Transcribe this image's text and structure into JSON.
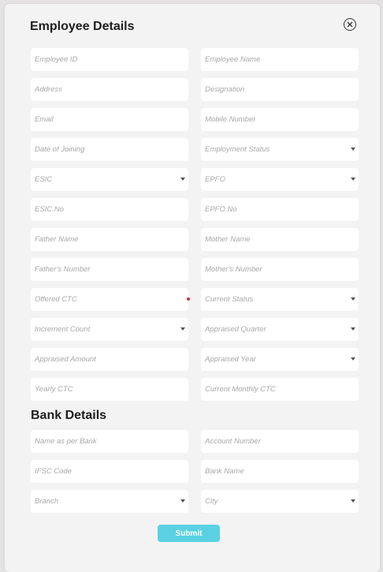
{
  "modal": {
    "title": "Employee Details",
    "bank_title": "Bank Details",
    "submit_label": "Submit"
  },
  "employee_fields": [
    {
      "label": "Employee ID",
      "type": "text"
    },
    {
      "label": "Employee Name",
      "type": "text"
    },
    {
      "label": "Address",
      "type": "text"
    },
    {
      "label": "Designation",
      "type": "text"
    },
    {
      "label": "Email",
      "type": "text"
    },
    {
      "label": "Mobile Number",
      "type": "text"
    },
    {
      "label": "Date of Joining",
      "type": "text"
    },
    {
      "label": "Employment Status",
      "type": "select"
    },
    {
      "label": "ESIC",
      "type": "select"
    },
    {
      "label": "EPFO",
      "type": "select"
    },
    {
      "label": "ESIC.No",
      "type": "text"
    },
    {
      "label": "EPFO.No",
      "type": "text"
    },
    {
      "label": "Father Name",
      "type": "text"
    },
    {
      "label": "Mother Name",
      "type": "text"
    },
    {
      "label": "Father's Number",
      "type": "text"
    },
    {
      "label": "Mother's Number",
      "type": "text"
    },
    {
      "label": "Offered CTC",
      "type": "text",
      "required": true
    },
    {
      "label": "Current Status",
      "type": "select"
    },
    {
      "label": "Increment Count",
      "type": "select"
    },
    {
      "label": "Appraised Quarter",
      "type": "select"
    },
    {
      "label": "Appraised Amount",
      "type": "text"
    },
    {
      "label": "Appraised Year",
      "type": "select"
    },
    {
      "label": "Yearly CTC",
      "type": "text"
    },
    {
      "label": "Current Monthly CTC",
      "type": "text"
    }
  ],
  "bank_fields": [
    {
      "label": "Name as per Bank",
      "type": "text"
    },
    {
      "label": "Account Number",
      "type": "text"
    },
    {
      "label": "IFSC Code",
      "type": "text"
    },
    {
      "label": "Bank Name",
      "type": "text"
    },
    {
      "label": "Branch",
      "type": "select"
    },
    {
      "label": "City",
      "type": "select"
    }
  ],
  "colors": {
    "required_dot": "#d9302c",
    "submit_bg": "#5ad1e2"
  },
  "icons": {
    "close": "close-circle-icon",
    "dropdown": "caret-down-icon"
  }
}
